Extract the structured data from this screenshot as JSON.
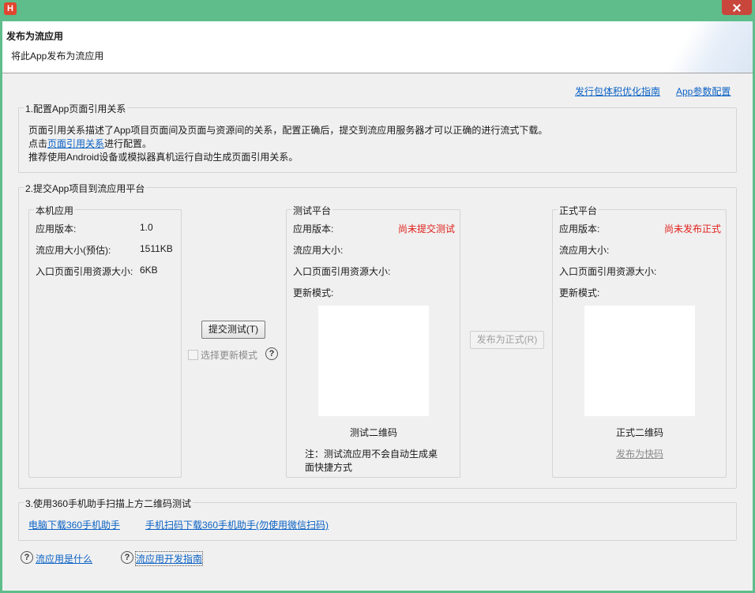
{
  "window": {
    "app_icon_letter": "H",
    "header_title": "发布为流应用",
    "header_subtitle": "将此App发布为流应用"
  },
  "top_links": {
    "optimize_guide": "发行包体积优化指南",
    "app_params": "App参数配置"
  },
  "section1": {
    "title": "1.配置App页面引用关系",
    "line1": "页面引用关系描述了App项目页面间及页面与资源间的关系，配置正确后，提交到流应用服务器才可以正确的进行流式下载。",
    "line2_prefix": "点击",
    "line2_link": "页面引用关系",
    "line2_suffix": "进行配置。",
    "line3": "推荐使用Android设备或模拟器真机运行自动生成页面引用关系。"
  },
  "section2": {
    "title": "2.提交App项目到流应用平台",
    "local": {
      "title": "本机应用",
      "version_label": "应用版本:",
      "version_value": "1.0",
      "size_label": "流应用大小(预估):",
      "size_value": "1511KB",
      "entry_label": "入口页面引用资源大小:",
      "entry_value": "6KB"
    },
    "submit_test_button": "提交测试(T)",
    "select_update_mode": "选择更新模式",
    "test": {
      "title": "测试平台",
      "version_label": "应用版本:",
      "version_status": "尚未提交测试",
      "size_label": "流应用大小:",
      "entry_label": "入口页面引用资源大小:",
      "update_mode_label": "更新模式:",
      "qr_label": "测试二维码",
      "note_line1": "注：测试流应用不会自动生成桌",
      "note_line2": "面快捷方式"
    },
    "publish_button": "发布为正式(R)",
    "release": {
      "title": "正式平台",
      "version_label": "应用版本:",
      "version_status": "尚未发布正式",
      "size_label": "流应用大小:",
      "entry_label": "入口页面引用资源大小:",
      "update_mode_label": "更新模式:",
      "qr_label": "正式二维码",
      "quick_app_link": "发布为快码"
    }
  },
  "section3": {
    "title": "3.使用360手机助手扫描上方二维码测试",
    "pc_download": "电脑下载360手机助手",
    "phone_download": "手机扫码下载360手机助手(勿使用微信扫码)"
  },
  "footer": {
    "what_is": "流应用是什么",
    "dev_guide": "流应用开发指南"
  },
  "colors": {
    "titlebar": "#5ebd8a",
    "link": "#0b62c4",
    "status_red": "#e0201b"
  }
}
